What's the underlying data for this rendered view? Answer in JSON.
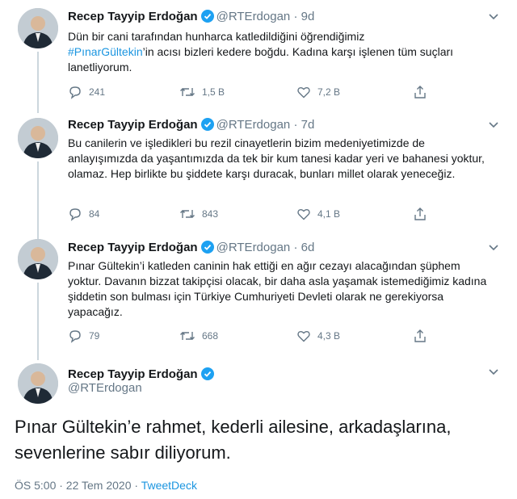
{
  "author": {
    "name": "Recep Tayyip Erdoğan",
    "handle": "@RTErdogan",
    "verified": true
  },
  "tweets": [
    {
      "age": "9d",
      "text_pre": "Dün bir cani tarafından hunharca katledildiğini öğrendiğimiz",
      "hashtag": "#PınarGültekin",
      "text_post": "’in acısı bizleri kedere boğdu. Kadına karşı işlenen tüm suçları lanetliyorum.",
      "replies": "241",
      "retweets": "1,5 B",
      "likes": "7,2 B"
    },
    {
      "age": "7d",
      "text": "Bu canilerin ve işledikleri bu rezil cinayetlerin bizim medeniyetimizde de anlayışımızda da yaşantımızda da tek bir kum tanesi kadar yeri ve bahanesi yoktur, olamaz. Hep birlikte bu şiddete karşı duracak, bunları millet olarak yeneceğiz.",
      "replies": "84",
      "retweets": "843",
      "likes": "4,1 B"
    },
    {
      "age": "6d",
      "text": "Pınar Gültekin’i katleden caninin hak ettiği en ağır cezayı alacağından şüphem yoktur. Davanın bizzat takipçisi olacak, bir daha asla yaşamak istemediğimiz kadına şiddetin son bulması için Türkiye Cumhuriyeti Devleti olarak ne gerekiyorsa yapacağız.",
      "replies": "79",
      "retweets": "668",
      "likes": "4,3 B"
    }
  ],
  "main_tweet": {
    "text": "Pınar Gültekin’e rahmet, kederli ailesine, arkadaşlarına, sevenlerine sabır diliyorum.",
    "time": "ÖS 5:00 · 22 Tem 2020",
    "separator": " · ",
    "source": "TweetDeck"
  },
  "colors": {
    "link": "#1b95e0",
    "muted": "#657786",
    "verified": "#1da1f2",
    "thread_line": "#ccd6dd"
  },
  "icons": [
    "verified-badge-icon",
    "chevron-down-icon",
    "reply-icon",
    "retweet-icon",
    "like-icon",
    "share-icon"
  ]
}
